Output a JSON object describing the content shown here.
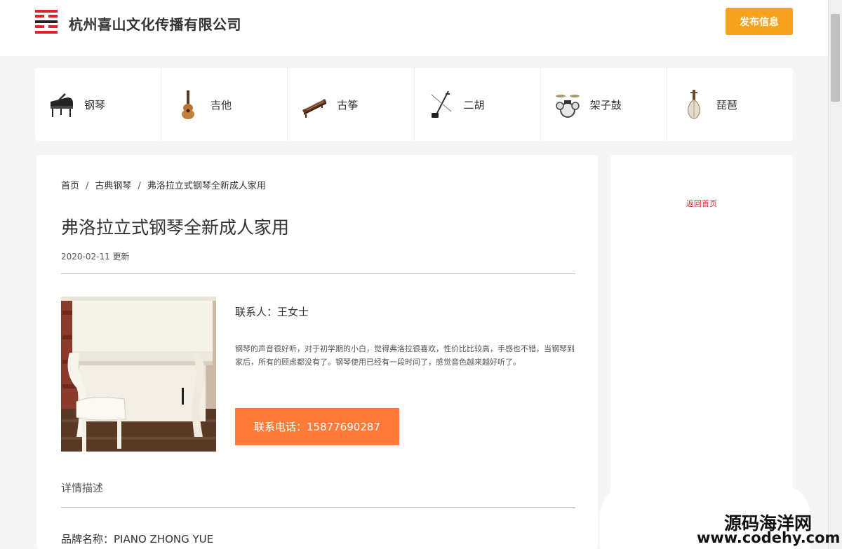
{
  "header": {
    "company_name": "杭州喜山文化传播有限公司",
    "publish_label": "发布信息"
  },
  "categories": [
    {
      "label": "钢琴",
      "icon": "piano-icon"
    },
    {
      "label": "吉他",
      "icon": "guitar-icon"
    },
    {
      "label": "古筝",
      "icon": "guzheng-icon"
    },
    {
      "label": "二胡",
      "icon": "erhu-icon"
    },
    {
      "label": "架子鼓",
      "icon": "drum-kit-icon"
    },
    {
      "label": "琵琶",
      "icon": "pipa-icon"
    }
  ],
  "breadcrumb": {
    "home": "首页",
    "category": "古典钢琴",
    "current": "弗洛拉立式钢琴全新成人家用",
    "separator": "/"
  },
  "listing": {
    "title": "弗洛拉立式钢琴全新成人家用",
    "date": "2020-02-11 更新",
    "contact": "联系人：王女士",
    "description": "钢琴的声音很好听，对于初学期的小白，觉得弗洛拉很喜欢，性价比比较高，手感也不错，当钢琴到家后，所有的顾虑都没有了。钢琴使用已经有一段时间了，感觉音色越来越好听了。",
    "phone_label": "联系电话：15877690287",
    "details_heading": "详情描述",
    "brand": "品牌名称：PIANO ZHONG YUE"
  },
  "sidebar": {
    "back_home": "返回首页"
  },
  "watermark": {
    "name": "源码海洋网",
    "url": "www.codehy.com"
  },
  "colors": {
    "publish_button": "#f7a21b",
    "phone_button": "#ff7b3a",
    "back_link": "#cc3333"
  }
}
